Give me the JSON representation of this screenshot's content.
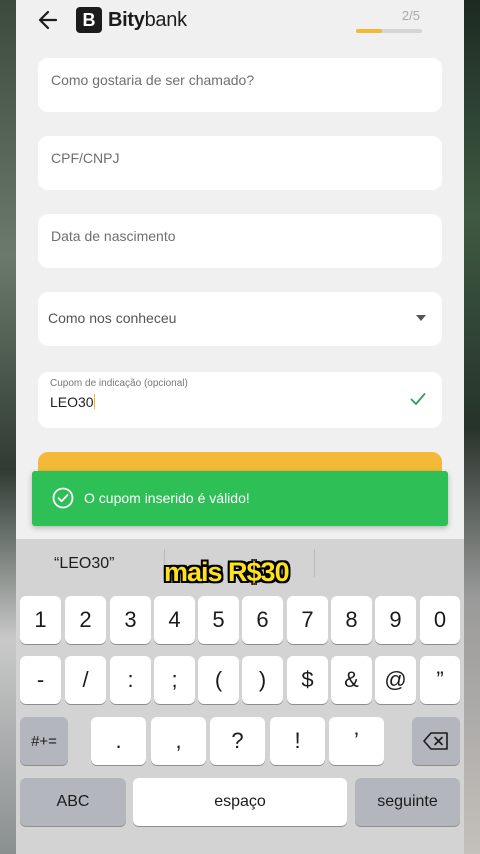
{
  "header": {
    "logo_mark": "B",
    "logo_bold": "Bity",
    "logo_light": "bank",
    "step": "2/5",
    "progress_fraction": 0.4
  },
  "form": {
    "name_placeholder": "Como gostaria de ser chamado?",
    "cpf_placeholder": "CPF/CNPJ",
    "birth_placeholder": "Data de nascimento",
    "source_placeholder": "Como nos conheceu",
    "coupon_label": "Cupom de indicação (opcional)",
    "coupon_value": "LEO30"
  },
  "toast": {
    "message": "O cupom inserido é válido!"
  },
  "overlay_caption": "mais R$30",
  "keyboard": {
    "suggestion": "“LEO30”",
    "row1": [
      "1",
      "2",
      "3",
      "4",
      "5",
      "6",
      "7",
      "8",
      "9",
      "0"
    ],
    "row2": [
      "-",
      "/",
      ":",
      ";",
      "(",
      ")",
      "$",
      "&",
      "@",
      "”"
    ],
    "row3_left": "#+=",
    "row3": [
      ".",
      ",",
      "?",
      "!",
      "’"
    ],
    "abc": "ABC",
    "space": "espaço",
    "next": "seguinte"
  },
  "colors": {
    "accent": "#f4b936",
    "success": "#2ebf57",
    "check": "#2e9e5b"
  },
  "icons": {
    "back": "arrow-left-icon",
    "dropdown": "chevron-down-icon",
    "valid": "checkmark-icon",
    "toast": "check-circle-icon",
    "delete": "backspace-icon"
  }
}
